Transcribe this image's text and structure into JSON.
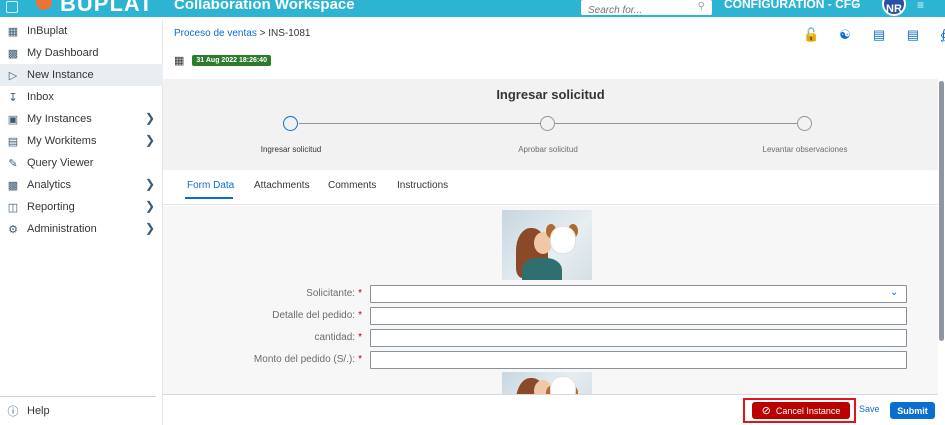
{
  "topbar": {
    "logo_text": "BUPLAT",
    "app_title": "Collaboration Workspace",
    "search_placeholder": "Search for...",
    "config_label": "CONFIGURATION - CFG",
    "avatar_initials": "NR"
  },
  "sidebar": {
    "items": [
      {
        "label": "InBuplat",
        "icon": "building-icon",
        "chevron": false,
        "active": false
      },
      {
        "label": "My Dashboard",
        "icon": "dashboard-icon",
        "chevron": false,
        "active": false
      },
      {
        "label": "New Instance",
        "icon": "new-instance-icon",
        "chevron": false,
        "active": true
      },
      {
        "label": "Inbox",
        "icon": "inbox-icon",
        "chevron": false,
        "active": false
      },
      {
        "label": "My Instances",
        "icon": "instances-icon",
        "chevron": true,
        "active": false
      },
      {
        "label": "My Workitems",
        "icon": "workitems-icon",
        "chevron": true,
        "active": false
      },
      {
        "label": "Query Viewer",
        "icon": "query-icon",
        "chevron": false,
        "active": false
      },
      {
        "label": "Analytics",
        "icon": "analytics-icon",
        "chevron": true,
        "active": false
      },
      {
        "label": "Reporting",
        "icon": "reporting-icon",
        "chevron": true,
        "active": false
      },
      {
        "label": "Administration",
        "icon": "admin-icon",
        "chevron": true,
        "active": false
      }
    ],
    "help_label": "Help"
  },
  "header": {
    "breadcrumb_link": "Proceso de ventas",
    "breadcrumb_sep": " > ",
    "breadcrumb_current": "INS-1081",
    "date_badge": "31 Aug 2022 18:26:40"
  },
  "wizard": {
    "title": "Ingresar solicitud",
    "steps": [
      "Ingresar solicitud",
      "Aprobar solicitud",
      "Levantar observaciones"
    ]
  },
  "tabs": [
    "Form Data",
    "Attachments",
    "Comments",
    "Instructions"
  ],
  "form": {
    "fields": [
      {
        "label": "Solicitante:",
        "value": ""
      },
      {
        "label": "Detalle del pedido:",
        "value": ""
      },
      {
        "label": "cantidad:",
        "value": ""
      },
      {
        "label": "Monto del pedido (S/.):",
        "value": ""
      }
    ],
    "required_mark": "*"
  },
  "footer": {
    "cancel_label": "Cancel Instance",
    "save_label": "Save",
    "submit_label": "Submit"
  },
  "colors": {
    "topbar": "#2db4d2",
    "accent": "#0a6ed1",
    "cancel": "#bb0000",
    "highlight_outline": "#e0151b",
    "date_badge": "#2b7d2b"
  }
}
